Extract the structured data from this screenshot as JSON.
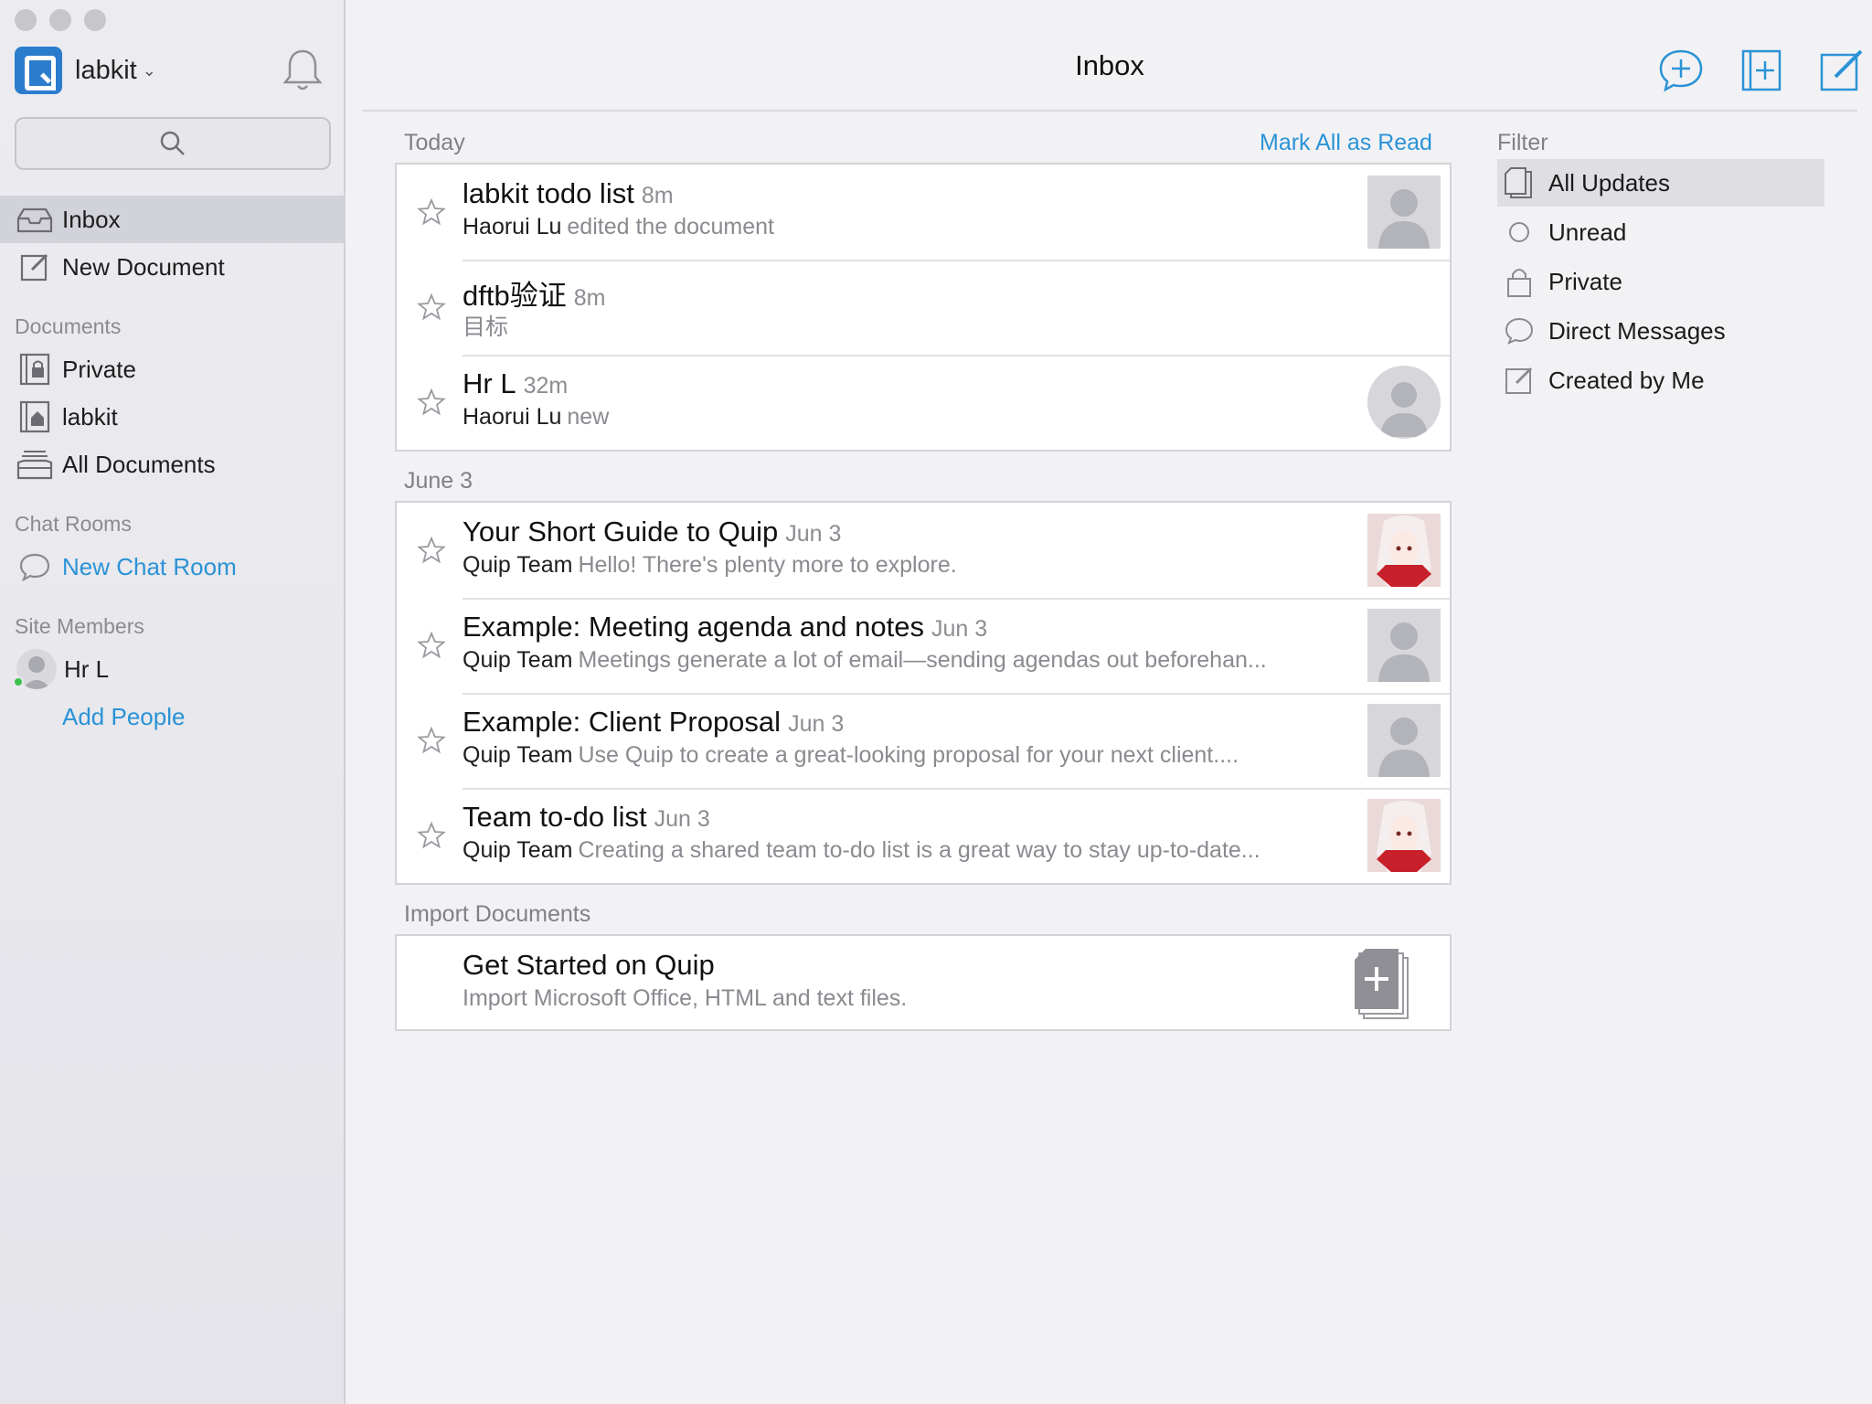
{
  "sidebar": {
    "workspace_name": "labkit",
    "nav": [
      {
        "label": "Inbox",
        "icon": "inbox-icon",
        "active": true
      },
      {
        "label": "New Document",
        "icon": "compose-icon",
        "active": false
      }
    ],
    "documents_label": "Documents",
    "documents": [
      {
        "label": "Private",
        "icon": "private-folder-icon"
      },
      {
        "label": "labkit",
        "icon": "home-folder-icon"
      },
      {
        "label": "All Documents",
        "icon": "archive-icon"
      }
    ],
    "chat_rooms_label": "Chat Rooms",
    "new_chat_room": "New Chat Room",
    "site_members_label": "Site Members",
    "members": [
      {
        "name": "Hr L",
        "online": true
      }
    ],
    "add_people": "Add People"
  },
  "header": {
    "title": "Inbox",
    "buttons": [
      "new-chat-icon",
      "new-folder-icon",
      "new-document-icon"
    ]
  },
  "inbox": {
    "mark_all_label": "Mark All as Read",
    "groups": [
      {
        "label": "Today",
        "items": [
          {
            "title": "labkit todo list",
            "time": "8m",
            "who": "Haorui Lu",
            "what": "edited the document",
            "thumb": "avatar-placeholder"
          },
          {
            "title": "dftb验证",
            "time": "8m",
            "who": "",
            "what": "目标",
            "thumb": "none"
          },
          {
            "title": "Hr L",
            "time": "32m",
            "who": "Haorui Lu",
            "what": "new",
            "thumb": "avatar-round"
          }
        ]
      },
      {
        "label": "June 3",
        "items": [
          {
            "title": "Your Short Guide to Quip",
            "time": "Jun 3",
            "who": "Quip Team",
            "what": "Hello! There's plenty more to explore.",
            "thumb": "anime-avatar"
          },
          {
            "title": "Example: Meeting agenda and notes",
            "time": "Jun 3",
            "who": "Quip Team",
            "what": "Meetings generate a lot of email—sending agendas out beforehan...",
            "thumb": "avatar-placeholder"
          },
          {
            "title": "Example: Client Proposal",
            "time": "Jun 3",
            "who": "Quip Team",
            "what": "Use Quip to create a great-looking proposal for your next client....",
            "thumb": "avatar-placeholder"
          },
          {
            "title": "Team to-do list",
            "time": "Jun 3",
            "who": "Quip Team",
            "what": "Creating a shared team to-do list is a great way to stay up-to-date...",
            "thumb": "anime-avatar"
          }
        ]
      }
    ],
    "import": {
      "label": "Import Documents",
      "title": "Get Started on Quip",
      "subtitle": "Import Microsoft Office, HTML and text files."
    }
  },
  "filter": {
    "label": "Filter",
    "items": [
      {
        "label": "All Updates",
        "icon": "all-updates-icon",
        "active": true
      },
      {
        "label": "Unread",
        "icon": "unread-circle-icon",
        "active": false
      },
      {
        "label": "Private",
        "icon": "lock-icon",
        "active": false
      },
      {
        "label": "Direct Messages",
        "icon": "chat-bubble-icon",
        "active": false
      },
      {
        "label": "Created by Me",
        "icon": "compose-icon",
        "active": false
      }
    ]
  },
  "colors": {
    "accent": "#2b93d6",
    "sidebar_bg": "#e8e8ed",
    "main_bg": "#f2f2f5",
    "online": "#3ec24a"
  }
}
